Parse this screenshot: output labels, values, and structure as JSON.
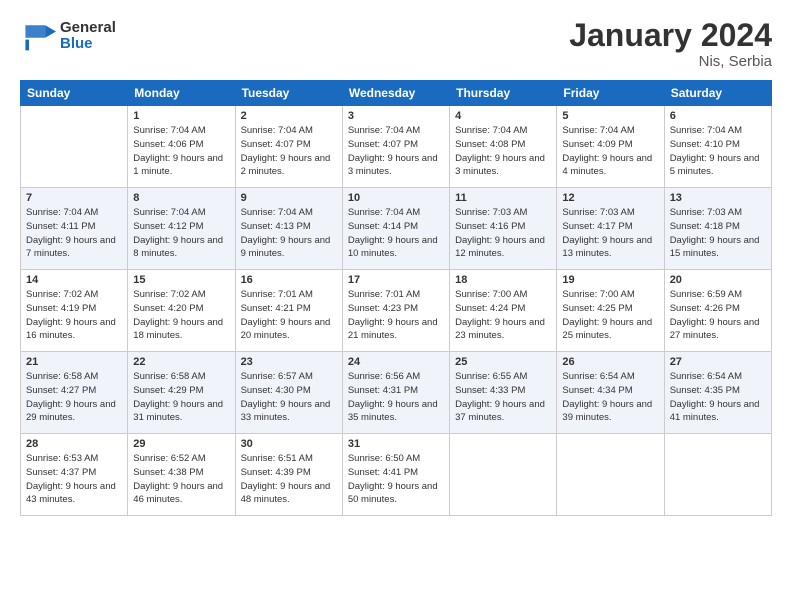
{
  "logo": {
    "general": "General",
    "blue": "Blue"
  },
  "header": {
    "month": "January 2024",
    "location": "Nis, Serbia"
  },
  "weekdays": [
    "Sunday",
    "Monday",
    "Tuesday",
    "Wednesday",
    "Thursday",
    "Friday",
    "Saturday"
  ],
  "weeks": [
    [
      {
        "day": "",
        "sunrise": "",
        "sunset": "",
        "daylight": ""
      },
      {
        "day": "1",
        "sunrise": "7:04 AM",
        "sunset": "4:06 PM",
        "daylight": "9 hours and 1 minute."
      },
      {
        "day": "2",
        "sunrise": "7:04 AM",
        "sunset": "4:07 PM",
        "daylight": "9 hours and 2 minutes."
      },
      {
        "day": "3",
        "sunrise": "7:04 AM",
        "sunset": "4:07 PM",
        "daylight": "9 hours and 3 minutes."
      },
      {
        "day": "4",
        "sunrise": "7:04 AM",
        "sunset": "4:08 PM",
        "daylight": "9 hours and 3 minutes."
      },
      {
        "day": "5",
        "sunrise": "7:04 AM",
        "sunset": "4:09 PM",
        "daylight": "9 hours and 4 minutes."
      },
      {
        "day": "6",
        "sunrise": "7:04 AM",
        "sunset": "4:10 PM",
        "daylight": "9 hours and 5 minutes."
      }
    ],
    [
      {
        "day": "7",
        "sunrise": "7:04 AM",
        "sunset": "4:11 PM",
        "daylight": "9 hours and 7 minutes."
      },
      {
        "day": "8",
        "sunrise": "7:04 AM",
        "sunset": "4:12 PM",
        "daylight": "9 hours and 8 minutes."
      },
      {
        "day": "9",
        "sunrise": "7:04 AM",
        "sunset": "4:13 PM",
        "daylight": "9 hours and 9 minutes."
      },
      {
        "day": "10",
        "sunrise": "7:04 AM",
        "sunset": "4:14 PM",
        "daylight": "9 hours and 10 minutes."
      },
      {
        "day": "11",
        "sunrise": "7:03 AM",
        "sunset": "4:16 PM",
        "daylight": "9 hours and 12 minutes."
      },
      {
        "day": "12",
        "sunrise": "7:03 AM",
        "sunset": "4:17 PM",
        "daylight": "9 hours and 13 minutes."
      },
      {
        "day": "13",
        "sunrise": "7:03 AM",
        "sunset": "4:18 PM",
        "daylight": "9 hours and 15 minutes."
      }
    ],
    [
      {
        "day": "14",
        "sunrise": "7:02 AM",
        "sunset": "4:19 PM",
        "daylight": "9 hours and 16 minutes."
      },
      {
        "day": "15",
        "sunrise": "7:02 AM",
        "sunset": "4:20 PM",
        "daylight": "9 hours and 18 minutes."
      },
      {
        "day": "16",
        "sunrise": "7:01 AM",
        "sunset": "4:21 PM",
        "daylight": "9 hours and 20 minutes."
      },
      {
        "day": "17",
        "sunrise": "7:01 AM",
        "sunset": "4:23 PM",
        "daylight": "9 hours and 21 minutes."
      },
      {
        "day": "18",
        "sunrise": "7:00 AM",
        "sunset": "4:24 PM",
        "daylight": "9 hours and 23 minutes."
      },
      {
        "day": "19",
        "sunrise": "7:00 AM",
        "sunset": "4:25 PM",
        "daylight": "9 hours and 25 minutes."
      },
      {
        "day": "20",
        "sunrise": "6:59 AM",
        "sunset": "4:26 PM",
        "daylight": "9 hours and 27 minutes."
      }
    ],
    [
      {
        "day": "21",
        "sunrise": "6:58 AM",
        "sunset": "4:27 PM",
        "daylight": "9 hours and 29 minutes."
      },
      {
        "day": "22",
        "sunrise": "6:58 AM",
        "sunset": "4:29 PM",
        "daylight": "9 hours and 31 minutes."
      },
      {
        "day": "23",
        "sunrise": "6:57 AM",
        "sunset": "4:30 PM",
        "daylight": "9 hours and 33 minutes."
      },
      {
        "day": "24",
        "sunrise": "6:56 AM",
        "sunset": "4:31 PM",
        "daylight": "9 hours and 35 minutes."
      },
      {
        "day": "25",
        "sunrise": "6:55 AM",
        "sunset": "4:33 PM",
        "daylight": "9 hours and 37 minutes."
      },
      {
        "day": "26",
        "sunrise": "6:54 AM",
        "sunset": "4:34 PM",
        "daylight": "9 hours and 39 minutes."
      },
      {
        "day": "27",
        "sunrise": "6:54 AM",
        "sunset": "4:35 PM",
        "daylight": "9 hours and 41 minutes."
      }
    ],
    [
      {
        "day": "28",
        "sunrise": "6:53 AM",
        "sunset": "4:37 PM",
        "daylight": "9 hours and 43 minutes."
      },
      {
        "day": "29",
        "sunrise": "6:52 AM",
        "sunset": "4:38 PM",
        "daylight": "9 hours and 46 minutes."
      },
      {
        "day": "30",
        "sunrise": "6:51 AM",
        "sunset": "4:39 PM",
        "daylight": "9 hours and 48 minutes."
      },
      {
        "day": "31",
        "sunrise": "6:50 AM",
        "sunset": "4:41 PM",
        "daylight": "9 hours and 50 minutes."
      },
      {
        "day": "",
        "sunrise": "",
        "sunset": "",
        "daylight": ""
      },
      {
        "day": "",
        "sunrise": "",
        "sunset": "",
        "daylight": ""
      },
      {
        "day": "",
        "sunrise": "",
        "sunset": "",
        "daylight": ""
      }
    ]
  ],
  "labels": {
    "sunrise": "Sunrise:",
    "sunset": "Sunset:",
    "daylight": "Daylight:"
  }
}
